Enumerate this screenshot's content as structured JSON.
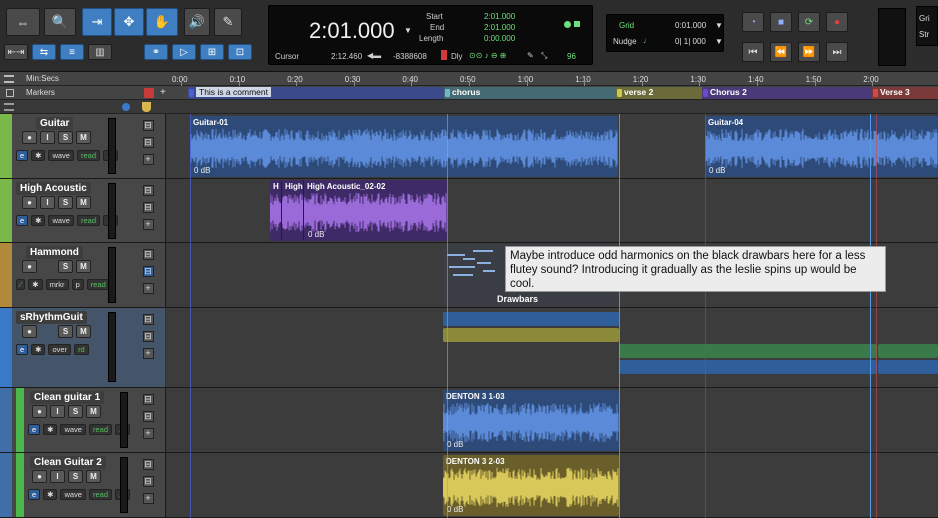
{
  "toolbar": {
    "counter": {
      "main_time": "2:01.000",
      "labels": {
        "start": "Start",
        "end": "End",
        "length": "Length",
        "cursor": "Cursor"
      },
      "start": "2:01.000",
      "end": "2:01.000",
      "length": "0:00.000",
      "cursor_value": "2:12.460",
      "sample_value": "-8388608",
      "dly_label": "Dly",
      "count": "96"
    },
    "grid": {
      "label": "Grid",
      "value": "0:01.000"
    },
    "nudge": {
      "label": "Nudge",
      "value": "0| 1| 000"
    },
    "right_box": [
      "Gri",
      "Str"
    ]
  },
  "ruler": {
    "timescale_label": "Min:Secs",
    "markers_label": "Markers",
    "ticks": [
      "0:00",
      "0:10",
      "0:20",
      "0:30",
      "0:40",
      "0:50",
      "1:00",
      "1:10",
      "1:20",
      "1:30",
      "1:40",
      "1:50",
      "2:00"
    ],
    "markers": [
      {
        "name": "This is a comment",
        "color": "#4a5fd6"
      },
      {
        "name": "chorus",
        "color": "#6fb8c8"
      },
      {
        "name": "verse 2",
        "color": "#c8c84a"
      },
      {
        "name": "Chorus 2",
        "color": "#6a4ad0"
      },
      {
        "name": "Verse 3",
        "color": "#d04a4a"
      }
    ]
  },
  "tracks": [
    {
      "name": "Guitar",
      "color": "#7ab84a",
      "buttons": [
        "●",
        "I",
        "S",
        "M"
      ],
      "chips": [
        "wave",
        "read"
      ],
      "clips": [
        {
          "name": "Guitar-01",
          "gain": "0 dB"
        },
        {
          "name": "Guitar-04",
          "gain": "0 dB"
        }
      ]
    },
    {
      "name": "High Acoustic",
      "color": "#7ab84a",
      "buttons": [
        "●",
        "I",
        "S",
        "M"
      ],
      "chips": [
        "wave",
        "read"
      ],
      "clips": [
        {
          "name": "H"
        },
        {
          "name": "High"
        },
        {
          "name": "High Acoustic_02-02",
          "gain": "0 dB"
        }
      ]
    },
    {
      "name": "Hammond",
      "color": "#b08a3a",
      "buttons": [
        "●",
        "S",
        "M"
      ],
      "chips": [
        "mrkr",
        "p",
        "read"
      ],
      "clips": [
        {
          "name": "Drawbars"
        }
      ]
    },
    {
      "name": "sRhythmGuit",
      "color": "#3a78c8",
      "buttons": [
        "●",
        "S",
        "M"
      ],
      "chips": [
        "over",
        "rd"
      ],
      "clips": []
    },
    {
      "name": "Clean guitar 1",
      "color": "#4ab84a",
      "buttons": [
        "●",
        "I",
        "S",
        "M"
      ],
      "chips": [
        "wave",
        "read"
      ],
      "clips": [
        {
          "name": "DENTON 3 1-03",
          "gain": "0 dB"
        }
      ]
    },
    {
      "name": "Clean Guitar 2",
      "color": "#4ab84a",
      "buttons": [
        "●",
        "I",
        "S",
        "M"
      ],
      "chips": [
        "wave",
        "read"
      ],
      "clips": [
        {
          "name": "DENTON 3 2-03",
          "gain": "0 dB"
        }
      ]
    }
  ],
  "comment": "Maybe introduce odd harmonics on the black drawbars here for a less flutey sound? Introducing it gradually as the leslie spins up would be cool.",
  "colors": {
    "blue_wave": "#5a8ad8",
    "purple_wave": "#9a6ad8",
    "yellow_wave": "#d8c85a",
    "selection_blue": "#3f7fc1"
  }
}
